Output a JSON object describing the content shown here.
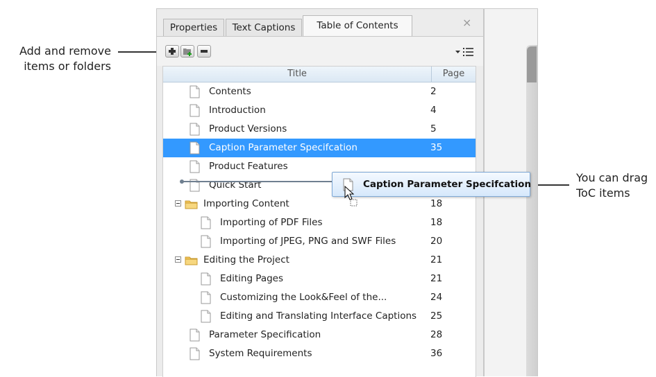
{
  "callouts": {
    "left_line1": "Add and remove",
    "left_line2": "items or folders",
    "right_line1": "You can drag",
    "right_line2": "ToC items"
  },
  "tabs": [
    {
      "label": "Properties",
      "active": false
    },
    {
      "label": "Text Captions",
      "active": false
    },
    {
      "label": "Table of Contents",
      "active": true
    }
  ],
  "close_glyph": "×",
  "toolbar": {
    "icons": [
      "add-item-icon",
      "add-folder-icon",
      "remove-icon",
      "list-view-dropdown-icon"
    ]
  },
  "tree": {
    "columns": {
      "title": "Title",
      "page": "Page"
    },
    "rows": [
      {
        "label": "Contents",
        "page": "2",
        "type": "doc",
        "level": 0
      },
      {
        "label": "Introduction",
        "page": "4",
        "type": "doc",
        "level": 0
      },
      {
        "label": "Product Versions",
        "page": "5",
        "type": "doc",
        "level": 0
      },
      {
        "label": "Caption Parameter Specifcation",
        "page": "35",
        "type": "doc",
        "level": 0,
        "selected": true
      },
      {
        "label": "Product Features",
        "page": "",
        "type": "doc",
        "level": 0
      },
      {
        "label": "Quick Start",
        "page": "",
        "type": "doc",
        "level": 0
      },
      {
        "label": "Importing Content",
        "page": "18",
        "type": "folder",
        "level": 0,
        "expanded": true
      },
      {
        "label": "Importing of PDF Files",
        "page": "18",
        "type": "doc",
        "level": 1
      },
      {
        "label": "Importing of JPEG, PNG and SWF Files",
        "page": "20",
        "type": "doc",
        "level": 1
      },
      {
        "label": "Editing the Project",
        "page": "21",
        "type": "folder",
        "level": 0,
        "expanded": true
      },
      {
        "label": "Editing Pages",
        "page": "21",
        "type": "doc",
        "level": 1
      },
      {
        "label": "Customizing the Look&Feel of the...",
        "page": "24",
        "type": "doc",
        "level": 1
      },
      {
        "label": "Editing and Translating Interface Captions",
        "page": "25",
        "type": "doc",
        "level": 1
      },
      {
        "label": "Parameter Specification",
        "page": "28",
        "type": "doc",
        "level": 0
      },
      {
        "label": "System Requirements",
        "page": "36",
        "type": "doc",
        "level": 0
      }
    ]
  },
  "drag_tooltip": {
    "label": "Caption Parameter Specifcation"
  },
  "colors": {
    "selection": "#3399ff",
    "folder": "#f3c55b",
    "tooltip_border": "#7fa9d6"
  }
}
